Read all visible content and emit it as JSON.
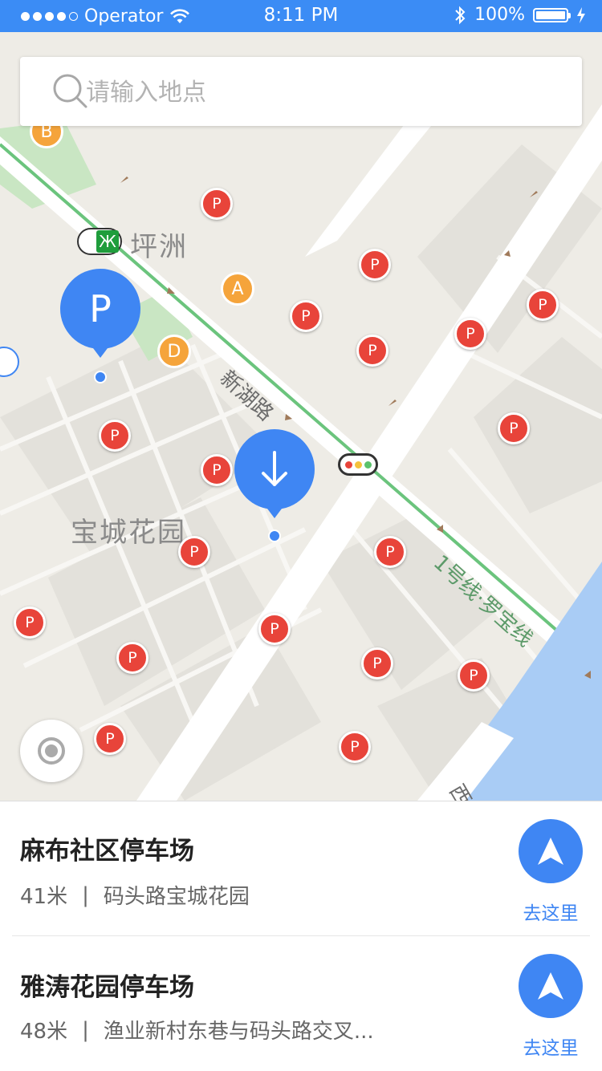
{
  "status_bar": {
    "carrier": "Operator",
    "time": "8:11 PM",
    "battery": "100%"
  },
  "search": {
    "placeholder": "请输入地点"
  },
  "map": {
    "station_name": "坪洲",
    "area_name": "宝城花园",
    "road_name": "新湖路",
    "rail_line_name": "1号线·罗宝线",
    "partial_label": "西",
    "entrances": [
      "A",
      "B",
      "D"
    ],
    "parking_marker_label": "P",
    "selected_pin_label": "P",
    "parking_marker_count": 19,
    "colors": {
      "accent": "#3f86f3",
      "parking_marker": "#e8443a",
      "entrance": "#f5a43b",
      "metro_line": "#6bc47d",
      "water": "#a9ccf5"
    }
  },
  "results": [
    {
      "name": "麻布社区停车场",
      "distance": "41米",
      "address": "码头路宝城花园",
      "action_label": "去这里"
    },
    {
      "name": "雅涛花园停车场",
      "distance": "48米",
      "address": "渔业新村东巷与码头路交叉...",
      "action_label": "去这里"
    }
  ],
  "separator": "|"
}
